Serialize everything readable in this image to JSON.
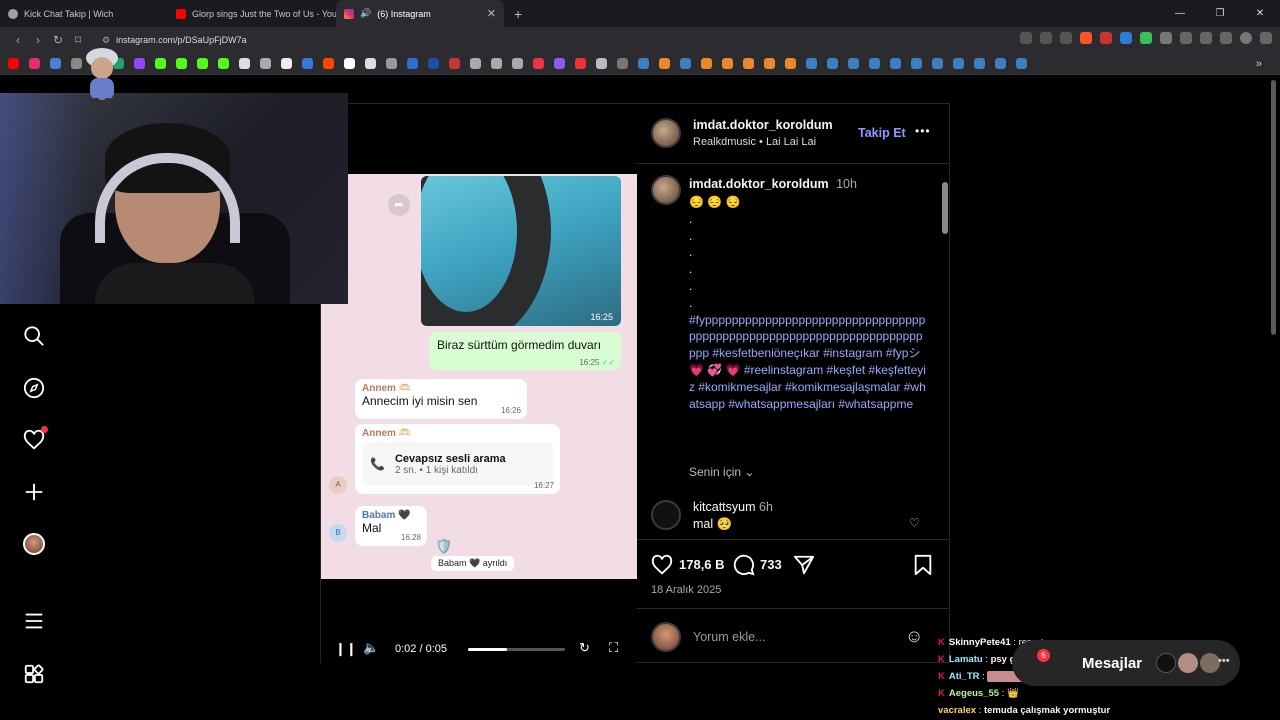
{
  "browser": {
    "tabs": [
      {
        "title": "Kick Chat Takip | Wich",
        "color": "#9ca3af"
      },
      {
        "title": "Glorp sings Just the Two of Us - YouTube",
        "color": "#ff0000"
      },
      {
        "title": "(6) Instagram",
        "color": "#e1306c"
      }
    ],
    "url": "instagram.com/p/DSaUpFjDW7a"
  },
  "post": {
    "author": "imdat.doktor_koroldum",
    "audio_artist": "Realkdmusic",
    "audio_title": "Lai Lai Lai",
    "follow_label": "Takip Et",
    "more_label": "•••",
    "caption_time": "10h",
    "caption_emojis": "😔 😔 😔",
    "dots": [
      ".",
      ".",
      ".",
      ".",
      ".",
      "."
    ],
    "hashtags": "#fyppppppppppppppppppppppppppppppppppppppppppppppppppppppppppppppppppppppp #kesfetbeniöneçıkar #instagram #fypシ💗 💞 💗 #reelinstagram #keşfet #keşfetteyiz #komikmesajlar #komikmesajlaşmalar #whatsapp #whatsappmesajları #whatsappme",
    "translation_label": "Senin için",
    "comment": {
      "user": "kitcattsyum",
      "time": "6h",
      "text": "mal 🥺"
    },
    "likes": "178,6 B",
    "comments_count": "733",
    "date": "18 Aralık 2025",
    "comment_placeholder": "Yorum ekle..."
  },
  "chat": {
    "photo_time": "16:25",
    "out_text": "Biraz sürttüm görmedim duvarı",
    "out_time": "16:25",
    "in1_sender": "Annem 🫶🏻",
    "in1_text": "Annecim iyi misin sen",
    "in1_time": "16:26",
    "in2_sender": "Annem 🫶🏻",
    "call_title": "Cevapsız sesli arama",
    "call_sub": "2 sn. • 1 kişi katıldı",
    "in2_time": "16:27",
    "avatar_a": "A",
    "in3_sender": "Babam 🖤",
    "in3_text": "Mal",
    "in3_time": "16:28",
    "avatar_b": "B",
    "system_note": "Babam 🖤 ayrıldı"
  },
  "video": {
    "time": "0:02 / 0:05",
    "progress": 0.4
  },
  "messages": {
    "label": "Mesajlar",
    "badge": "6"
  },
  "kick_chat": [
    {
      "user": "SkinnyPete41",
      "text": "report",
      "color": "#ffffff"
    },
    {
      "user": "Lamatu",
      "text": "psy gangam style adam",
      "color": "#9ee6ff"
    },
    {
      "user": "Ati_TR",
      "text": "",
      "color": "#9ee6ff"
    },
    {
      "user": "Aegeus_55",
      "text": "👑",
      "color": "#b2f59b"
    },
    {
      "user": "vacralex",
      "text": "temuda çalışmak yormuştur",
      "color": "#ffd36b"
    }
  ]
}
